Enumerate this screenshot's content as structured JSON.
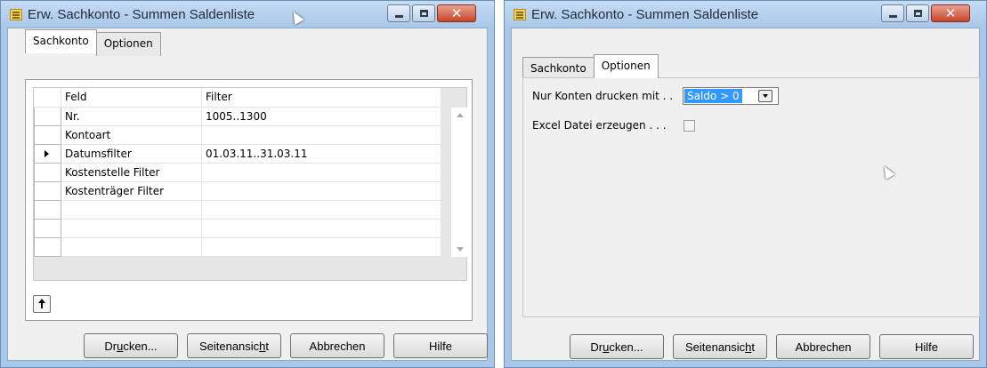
{
  "left_window": {
    "title": "Erw. Sachkonto - Summen Saldenliste",
    "tabs": [
      {
        "label": "Sachkonto",
        "active": true
      },
      {
        "label": "Optionen",
        "active": false
      }
    ],
    "columns": [
      "Feld",
      "Filter"
    ],
    "rows": [
      {
        "feld": "Nr.",
        "filter": "1005..1300",
        "current": false
      },
      {
        "feld": "Kontoart",
        "filter": "",
        "current": false
      },
      {
        "feld": "Datumsfilter",
        "filter": "01.03.11..31.03.11",
        "current": true
      },
      {
        "feld": "Kostenstelle Filter",
        "filter": "",
        "current": false
      },
      {
        "feld": "Kostenträger Filter",
        "filter": "",
        "current": false
      },
      {
        "feld": "",
        "filter": "",
        "current": false
      },
      {
        "feld": "",
        "filter": "",
        "current": false
      },
      {
        "feld": "",
        "filter": "",
        "current": false
      }
    ]
  },
  "right_window": {
    "title": "Erw. Sachkonto - Summen Saldenliste",
    "tabs": [
      {
        "label": "Sachkonto",
        "active": false
      },
      {
        "label": "Optionen",
        "active": true
      }
    ],
    "options": {
      "print_accounts_label": "Nur Konten drucken mit . .",
      "print_accounts_value": "Saldo > 0",
      "excel_label": "Excel Datei erzeugen . . .",
      "excel_checked": false
    }
  },
  "buttons": {
    "print": {
      "pre": "Dr",
      "u": "u",
      "post": "cken..."
    },
    "preview": {
      "pre": "Seitenansic",
      "u": "h",
      "post": "t"
    },
    "cancel": "Abbrechen",
    "help": "Hilfe"
  }
}
